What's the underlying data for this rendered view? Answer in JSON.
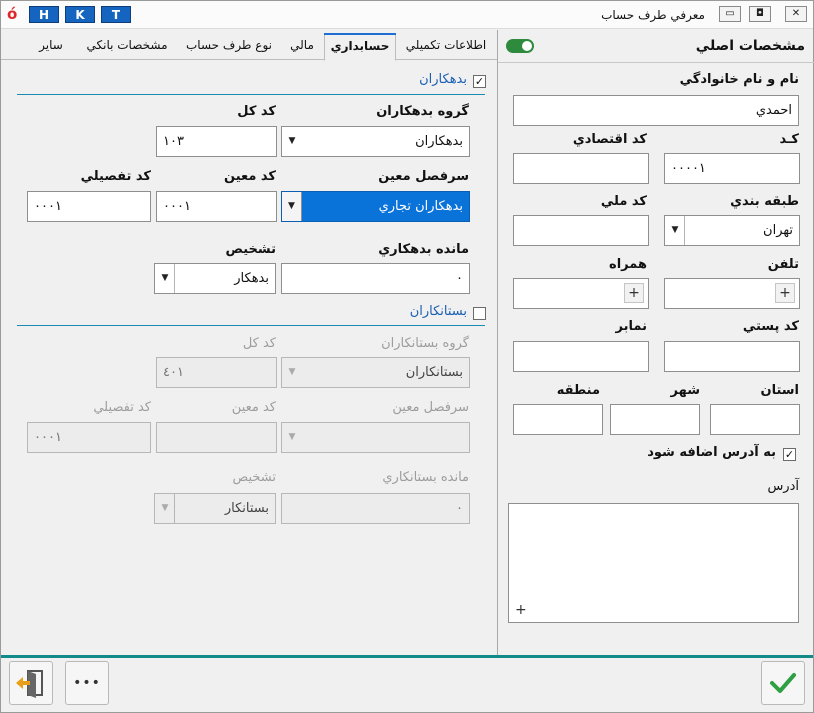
{
  "window": {
    "title": "معرفي طرف حساب",
    "logo": "ó",
    "hkt": [
      "H",
      "K",
      "T"
    ],
    "controls": {
      "minimize": "▭",
      "restore": "◘",
      "close": "✕"
    }
  },
  "tabs": [
    {
      "label": "اطلاعات تكميلي"
    },
    {
      "label": "حسابداري"
    },
    {
      "label": "مالي"
    },
    {
      "label": "نوع طرف حساب"
    },
    {
      "label": "مشخصات بانكي"
    },
    {
      "label": "ساير"
    }
  ],
  "debtors": {
    "section_title": "بدهكاران",
    "checked": true,
    "group_label": "گروه بدهكاران",
    "group_value": "بدهكاران",
    "kol_label": "كد كل",
    "kol_value": "١٠٣",
    "sarfasl_label": "سرفصل معين",
    "sarfasl_value": "بدهكاران تجاري",
    "moein_label": "كد معين",
    "moein_value": "٠٠٠١",
    "tafsili_label": "كد تفصيلي",
    "tafsili_value": "٠٠٠١",
    "mande_label": "مانده بدهكاري",
    "mande_value": "٠",
    "tashkhis_label": "تشخيص",
    "tashkhis_value": "بدهكار"
  },
  "creditors": {
    "section_title": "بستانكاران",
    "checked": false,
    "group_label": "گروه بستانكاران",
    "group_value": "بستانكاران",
    "kol_label": "كد كل",
    "kol_value": "٤٠١",
    "sarfasl_label": "سرفصل معين",
    "moein_label": "كد معين",
    "tafsili_label": "كد تفصيلي",
    "tafsili_value": "٠٠٠١",
    "mande_label": "مانده بستانكاري",
    "mande_value": "٠",
    "tashkhis_label": "تشخيص",
    "tashkhis_value": "بستانكار"
  },
  "main": {
    "title": "مشخصات اصلي",
    "name_label": "نام و نام خانوادگي",
    "name_value": "احمدي",
    "code_label": "كـد",
    "code_value": "٠٠٠٠١",
    "eco_label": "كد اقتصادي",
    "class_label": "طبقه بندي",
    "class_value": "تهران",
    "national_label": "كد ملي",
    "phone_label": "تلفن",
    "mobile_label": "همراه",
    "postal_label": "كد پستي",
    "fax_label": "نمابر",
    "province_label": "استان",
    "city_label": "شهر",
    "region_label": "منطقه",
    "add_to_address_label": "به آدرس اضافه شود",
    "add_to_address_checked": true,
    "address_label": "آدرس",
    "plus": "+"
  },
  "footer": {
    "more": "•••"
  },
  "colors": {
    "accent": "#1e6fd1",
    "section": "#1a5fb4",
    "teal": "#138a8a",
    "confirm": "#2ea043",
    "toggle": "#2e8b3e",
    "exit": "#e8a018"
  }
}
